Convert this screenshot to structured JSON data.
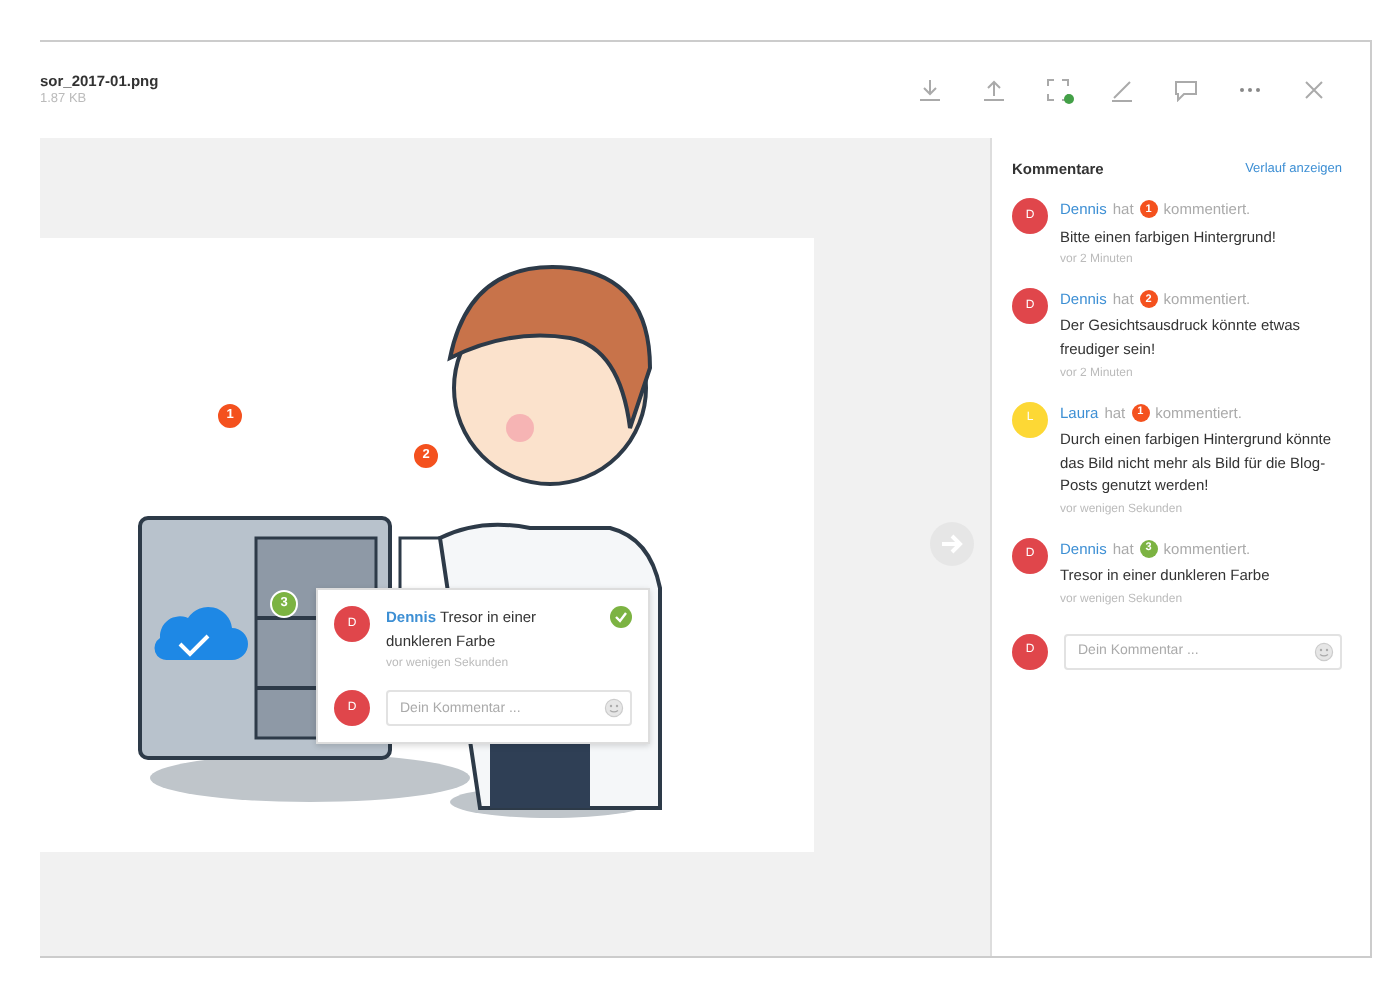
{
  "file": {
    "name": "sor_2017-01.png",
    "size": "1.87 KB"
  },
  "toolbar": [
    {
      "kind": "download"
    },
    {
      "kind": "upload"
    },
    {
      "kind": "fullscreen",
      "status_dot": true
    },
    {
      "kind": "edit"
    },
    {
      "kind": "comment"
    },
    {
      "kind": "more"
    },
    {
      "kind": "close"
    }
  ],
  "pins": [
    {
      "label": "1",
      "color": "#f4511e"
    },
    {
      "label": "2",
      "color": "#f4511e"
    },
    {
      "label": "3",
      "color": "#7cb342"
    }
  ],
  "popup": {
    "avatar": {
      "letter": "D",
      "color": "#e0464b"
    },
    "author": "Dennis",
    "text": "Tresor in einer dunkleren Farbe",
    "resolved": true,
    "time": "vor wenigen Sekunden",
    "reply": {
      "avatar": {
        "letter": "D",
        "color": "#e0464b"
      },
      "placeholder": "Dein Kommentar ..."
    }
  },
  "panel": {
    "title": "Kommentare",
    "history_link": "Verlauf anzeigen",
    "comments": [
      {
        "avatar": {
          "letter": "D",
          "color": "#e0464b"
        },
        "author": "Dennis",
        "hat": "hat",
        "pin": {
          "label": "1",
          "color": "#f4511e"
        },
        "verb": "kommentiert.",
        "text": "Bitte einen farbigen Hintergrund!",
        "time": "vor 2 Minuten"
      },
      {
        "avatar": {
          "letter": "D",
          "color": "#e0464b"
        },
        "author": "Dennis",
        "hat": "hat",
        "pin": {
          "label": "2",
          "color": "#f4511e"
        },
        "verb": "kommentiert.",
        "text": "Der Gesichtsausdruck könnte etwas freudiger sein!",
        "time": "vor 2 Minuten"
      },
      {
        "avatar": {
          "letter": "L",
          "color": "#fdd835"
        },
        "author": "Laura",
        "hat": "hat",
        "pin": {
          "label": "1",
          "color": "#f4511e"
        },
        "verb": "kommentiert.",
        "text": "Durch einen farbigen Hintergrund könnte das Bild nicht mehr als Bild für die Blog-Posts genutzt werden!",
        "time": "vor wenigen Sekunden"
      },
      {
        "avatar": {
          "letter": "D",
          "color": "#e0464b"
        },
        "author": "Dennis",
        "hat": "hat",
        "pin": {
          "label": "3",
          "color": "#7cb342"
        },
        "verb": "kommentiert.",
        "text": "Tresor in einer dunkleren Farbe",
        "time": "vor wenigen Sekunden"
      }
    ],
    "reply": {
      "avatar": {
        "letter": "D",
        "color": "#e0464b"
      },
      "placeholder": "Dein Kommentar ..."
    }
  }
}
